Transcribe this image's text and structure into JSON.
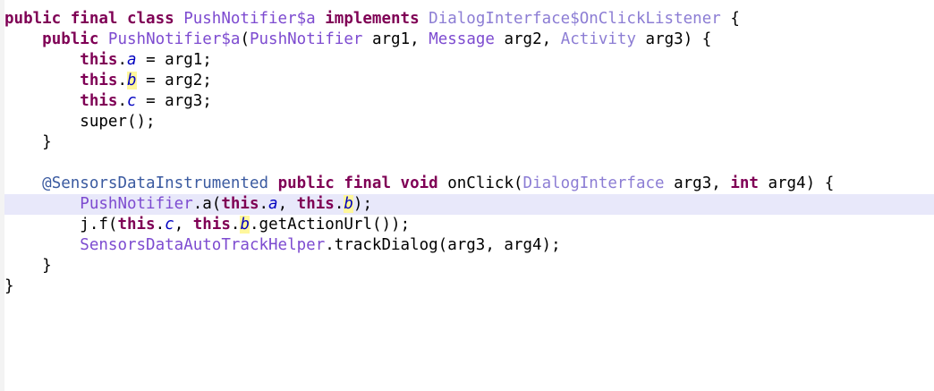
{
  "editor": {
    "lines": [
      {
        "segments": [
          {
            "t": "public final class ",
            "c": "kw"
          },
          {
            "t": "PushNotifier$a",
            "c": "ty"
          },
          {
            "t": " ",
            "c": "plain"
          },
          {
            "t": "implements",
            "c": "kw"
          },
          {
            "t": " ",
            "c": "plain"
          },
          {
            "t": "DialogInterface$OnClickListener",
            "c": "ix"
          },
          {
            "t": " {",
            "c": "plain"
          }
        ]
      },
      {
        "segments": [
          {
            "t": "    ",
            "c": "plain"
          },
          {
            "t": "public ",
            "c": "kw"
          },
          {
            "t": "PushNotifier$a",
            "c": "ty"
          },
          {
            "t": "(",
            "c": "plain"
          },
          {
            "t": "PushNotifier",
            "c": "ty"
          },
          {
            "t": " arg1, ",
            "c": "plain"
          },
          {
            "t": "Message",
            "c": "ty"
          },
          {
            "t": " arg2, ",
            "c": "plain"
          },
          {
            "t": "Activity",
            "c": "ix"
          },
          {
            "t": " arg3) {",
            "c": "plain"
          }
        ]
      },
      {
        "segments": [
          {
            "t": "        ",
            "c": "plain"
          },
          {
            "t": "this",
            "c": "kw"
          },
          {
            "t": ".",
            "c": "plain"
          },
          {
            "t": "a",
            "c": "fld"
          },
          {
            "t": " = arg1;",
            "c": "plain"
          }
        ]
      },
      {
        "segments": [
          {
            "t": "        ",
            "c": "plain"
          },
          {
            "t": "this",
            "c": "kw"
          },
          {
            "t": ".",
            "c": "plain"
          },
          {
            "t": "b",
            "c": "fld occ"
          },
          {
            "t": " = arg2;",
            "c": "plain"
          }
        ]
      },
      {
        "segments": [
          {
            "t": "        ",
            "c": "plain"
          },
          {
            "t": "this",
            "c": "kw"
          },
          {
            "t": ".",
            "c": "plain"
          },
          {
            "t": "c",
            "c": "fld"
          },
          {
            "t": " = arg3;",
            "c": "plain"
          }
        ]
      },
      {
        "segments": [
          {
            "t": "        super();",
            "c": "plain"
          }
        ]
      },
      {
        "segments": [
          {
            "t": "    }",
            "c": "plain"
          }
        ]
      },
      {
        "segments": []
      },
      {
        "segments": [
          {
            "t": "    ",
            "c": "plain"
          },
          {
            "t": "@SensorsDataInstrumented",
            "c": "ann"
          },
          {
            "t": " ",
            "c": "plain"
          },
          {
            "t": "public final void",
            "c": "kw"
          },
          {
            "t": " onClick(",
            "c": "plain"
          },
          {
            "t": "DialogInterface",
            "c": "ix"
          },
          {
            "t": " arg3, ",
            "c": "plain"
          },
          {
            "t": "int",
            "c": "kw"
          },
          {
            "t": " arg4) {",
            "c": "plain"
          }
        ]
      },
      {
        "current": true,
        "segments": [
          {
            "t": "        ",
            "c": "plain"
          },
          {
            "t": "PushNotifier",
            "c": "ty"
          },
          {
            "t": ".a(",
            "c": "plain"
          },
          {
            "t": "this",
            "c": "kw"
          },
          {
            "t": ".",
            "c": "plain"
          },
          {
            "t": "a",
            "c": "fld"
          },
          {
            "t": ", ",
            "c": "plain"
          },
          {
            "t": "this",
            "c": "kw"
          },
          {
            "t": ".",
            "c": "plain"
          },
          {
            "t": "b",
            "c": "fld occ"
          },
          {
            "t": ");",
            "c": "plain"
          }
        ]
      },
      {
        "segments": [
          {
            "t": "        j.f(",
            "c": "plain"
          },
          {
            "t": "this",
            "c": "kw"
          },
          {
            "t": ".",
            "c": "plain"
          },
          {
            "t": "c",
            "c": "fld"
          },
          {
            "t": ", ",
            "c": "plain"
          },
          {
            "t": "this",
            "c": "kw"
          },
          {
            "t": ".",
            "c": "plain"
          },
          {
            "t": "b",
            "c": "fld occ"
          },
          {
            "t": ".getActionUrl());",
            "c": "plain"
          }
        ]
      },
      {
        "segments": [
          {
            "t": "        ",
            "c": "plain"
          },
          {
            "t": "SensorsDataAutoTrackHelper",
            "c": "ty"
          },
          {
            "t": ".trackDialog(arg3, arg4);",
            "c": "plain"
          }
        ]
      },
      {
        "segments": [
          {
            "t": "    }",
            "c": "plain"
          }
        ]
      },
      {
        "segments": [
          {
            "t": "}",
            "c": "plain"
          }
        ]
      }
    ]
  },
  "colors": {
    "keyword": "#7f0055",
    "type": "#7d4bd0",
    "interface": "#8c7dd4",
    "field": "#0000c0",
    "annotation": "#3a5aa0",
    "current_line": "#e8e8fa",
    "occurrence_highlight": "#fff79c"
  }
}
